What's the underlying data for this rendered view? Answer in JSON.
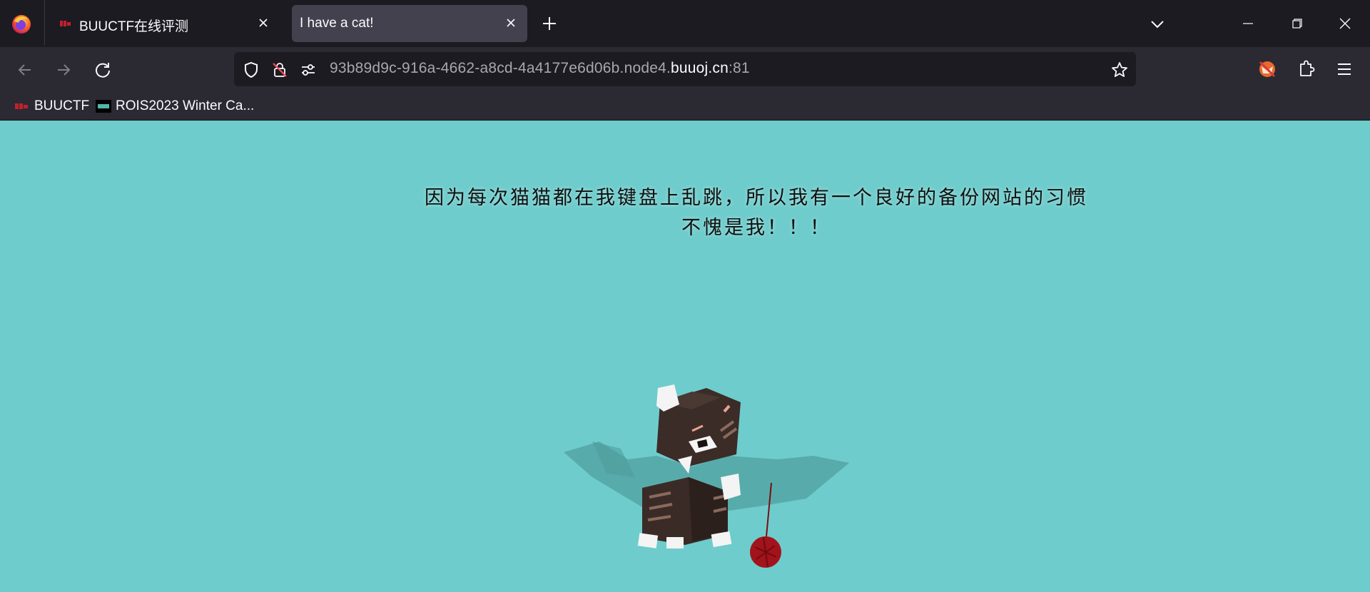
{
  "browser": {
    "tabs": [
      {
        "title": "BUUCTF在线评测",
        "active": false
      },
      {
        "title": "I have a cat!",
        "active": true
      }
    ],
    "url": {
      "prefix": "93b89d9c-916a-4662-a8cd-4a4177e6d06b.node4.",
      "domain": "buuoj.cn",
      "port": ":81"
    },
    "bookmarks": [
      {
        "label": "BUUCTF",
        "icon": "buuctf-favicon"
      },
      {
        "label": "ROIS2023 Winter Ca...",
        "icon": "rois-favicon"
      }
    ]
  },
  "page": {
    "line1": "因为每次猫猫都在我键盘上乱跳，所以我有一个良好的备份网站的习惯",
    "line2": "不愧是我！！！",
    "background_color": "#6fcccc"
  }
}
